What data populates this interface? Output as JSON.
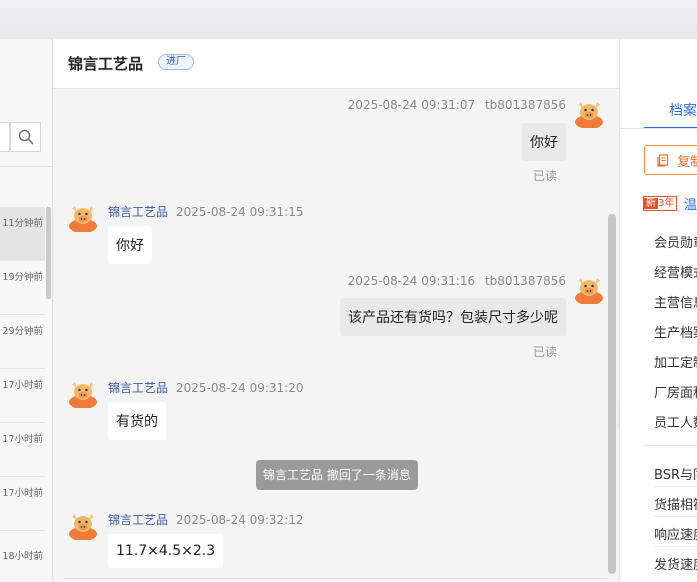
{
  "chat": {
    "title": "锦言工艺品",
    "tag": "进厂",
    "messages": [
      {
        "dir": "out",
        "sender": "tb801387856",
        "time": "2025-08-24 09:31:07",
        "text": "你好",
        "status": "已读"
      },
      {
        "dir": "in",
        "sender": "锦言工艺品",
        "time": "2025-08-24 09:31:15",
        "text": "你好"
      },
      {
        "dir": "out",
        "sender": "tb801387856",
        "time": "2025-08-24 09:31:16",
        "text": "该产品还有货吗？包装尺寸多少呢",
        "status": "已读"
      },
      {
        "dir": "in",
        "sender": "锦言工艺品",
        "time": "2025-08-24 09:31:20",
        "text": "有货的"
      },
      {
        "dir": "in",
        "sender": "锦言工艺品",
        "time": "2025-08-24 09:32:12",
        "text": "11.7×4.5×2.3"
      }
    ],
    "recall_notice": "锦言工艺品 撤回了一条消息"
  },
  "sessions": [
    {
      "time": "11分钟前"
    },
    {
      "time": "19分钟前"
    },
    {
      "time": "29分钟前"
    },
    {
      "time": "17小时前"
    },
    {
      "time": "17小时前"
    },
    {
      "time": "17小时前"
    },
    {
      "time": "18小时前"
    }
  ],
  "right_panel": {
    "tab": "档案",
    "copy_button": "复制",
    "badge_new": "新",
    "badge_years": "3年",
    "badge_text": "温",
    "items": [
      "会员勋章",
      "经营模式",
      "主营信息",
      "生产档案",
      "加工定制",
      "厂房面积",
      "员工人数"
    ],
    "items2": [
      "BSR与同行",
      "货描相符",
      "响应速度",
      "发货速度"
    ]
  },
  "icons": {
    "search": "search-icon",
    "collapse": "double-chevron-right-icon",
    "copy": "copy-icon",
    "avatar": "cartoon-avatar-icon"
  },
  "colors": {
    "accent": "#2f6bd8",
    "copy_border": "#f08a3a",
    "badge": "#e2532b"
  }
}
